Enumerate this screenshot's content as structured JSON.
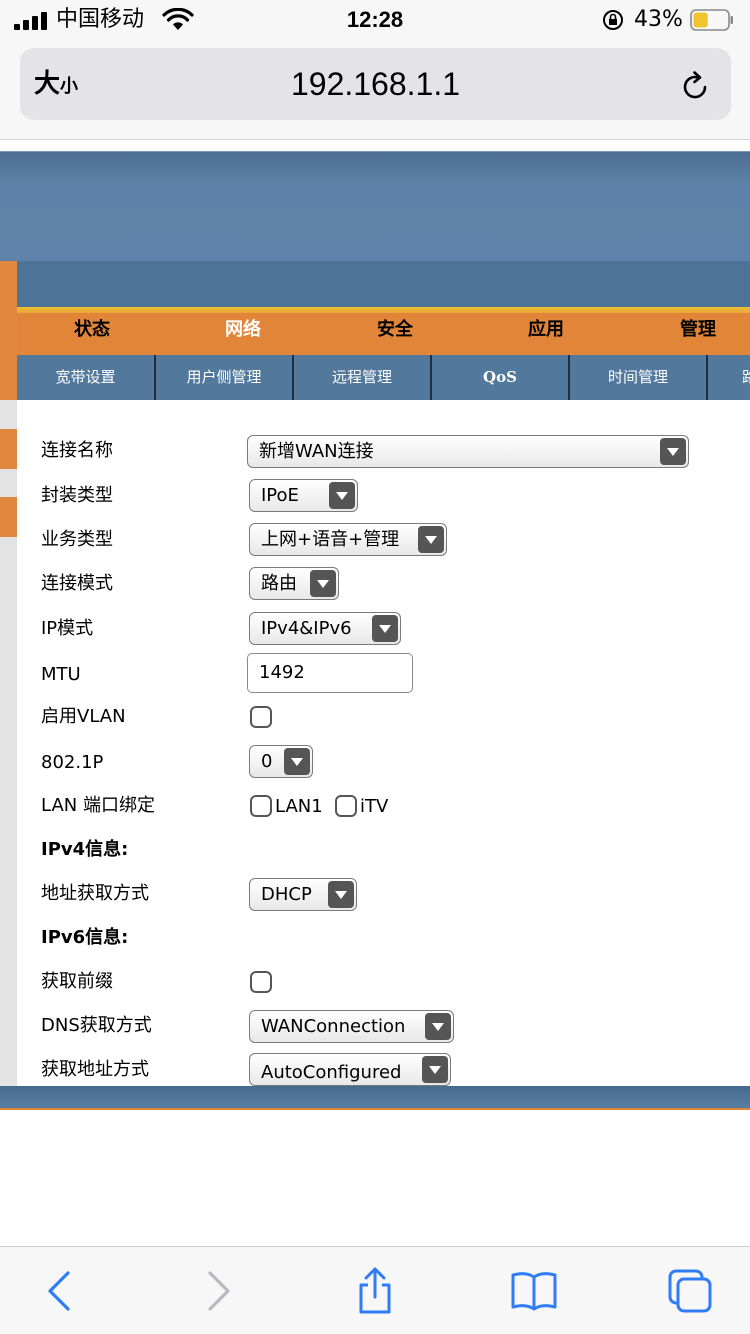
{
  "status_bar": {
    "carrier": "中国移动",
    "time": "12:28",
    "battery_percent": "43%",
    "battery_level": 0.43
  },
  "browser": {
    "text_size_label_big": "大",
    "text_size_label_small": "小",
    "url": "192.168.1.1"
  },
  "nav": {
    "main": [
      {
        "label": "状态",
        "active": false
      },
      {
        "label": "网络",
        "active": true
      },
      {
        "label": "安全",
        "active": false
      },
      {
        "label": "应用",
        "active": false
      },
      {
        "label": "管理",
        "active": false
      }
    ],
    "sub": [
      {
        "label": "宽带设置"
      },
      {
        "label": "用户侧管理"
      },
      {
        "label": "远程管理"
      },
      {
        "label": "QoS"
      },
      {
        "label": "时间管理"
      },
      {
        "label": "路"
      }
    ]
  },
  "form": {
    "connection_name": {
      "label": "连接名称",
      "value": "新增WAN连接"
    },
    "encapsulation": {
      "label": "封装类型",
      "value": "IPoE"
    },
    "service_type": {
      "label": "业务类型",
      "value": "上网+语音+管理"
    },
    "connection_mode": {
      "label": "连接模式",
      "value": "路由"
    },
    "ip_mode": {
      "label": "IP模式",
      "value": "IPv4&IPv6"
    },
    "mtu": {
      "label": "MTU",
      "value": "1492"
    },
    "enable_vlan": {
      "label": "启用VLAN",
      "checked": false
    },
    "dot1p": {
      "label": "802.1P",
      "value": "0"
    },
    "lan_binding": {
      "label": "LAN 端口绑定",
      "options": [
        "LAN1",
        "iTV"
      ]
    },
    "ipv4_header": "IPv4信息:",
    "ipv4_address_mode": {
      "label": "地址获取方式",
      "value": "DHCP"
    },
    "ipv6_header": "IPv6信息:",
    "get_prefix": {
      "label": "获取前缀",
      "checked": false
    },
    "dns_mode": {
      "label": "DNS获取方式",
      "value": "WANConnection"
    },
    "ipv6_address_mode": {
      "label": "获取地址方式",
      "value": "AutoConfigured"
    }
  }
}
